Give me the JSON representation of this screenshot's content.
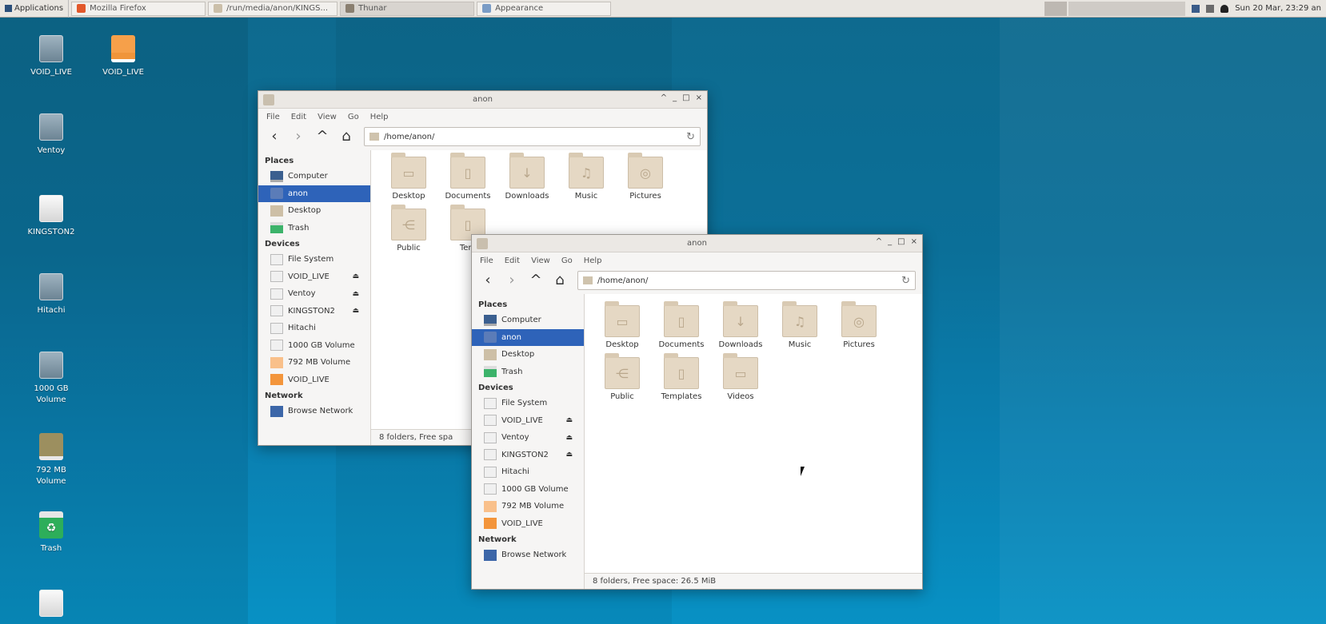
{
  "panel": {
    "apps_label": "Applications",
    "tasks": [
      {
        "label": "Mozilla Firefox",
        "active": false,
        "color": "#e2582b"
      },
      {
        "label": "/run/media/anon/KINGS...",
        "active": false,
        "color": "#cbbfa9"
      },
      {
        "label": "Thunar",
        "active": true,
        "color": "#8a7f70"
      },
      {
        "label": "Appearance",
        "active": false,
        "color": "#7a9cc6"
      }
    ],
    "clock": "Sun 20 Mar, 23:29",
    "user": "an"
  },
  "desktop": {
    "icons": [
      {
        "label": "VOID_LIVE"
      },
      {
        "label": "VOID_LIVE"
      },
      {
        "label": "Ventoy"
      },
      {
        "label": "KINGSTON2"
      },
      {
        "label": "Hitachi"
      },
      {
        "label": "1000 GB Volume"
      },
      {
        "label": "792 MB Volume"
      },
      {
        "label": "Trash"
      }
    ]
  },
  "window_back": {
    "title": "anon",
    "menu": [
      "File",
      "Edit",
      "View",
      "Go",
      "Help"
    ],
    "path": "/home/anon/",
    "sections": {
      "places": "Places",
      "devices": "Devices",
      "network": "Network"
    },
    "places": [
      "Computer",
      "anon",
      "Desktop",
      "Trash"
    ],
    "devices": [
      "File System",
      "VOID_LIVE",
      "Ventoy",
      "KINGSTON2",
      "Hitachi",
      "1000 GB Volume",
      "792 MB Volume",
      "VOID_LIVE"
    ],
    "network": [
      "Browse Network"
    ],
    "folders": [
      "Desktop",
      "Documents",
      "Downloads",
      "Music",
      "Pictures",
      "Public",
      "Tem"
    ],
    "status": "8 folders, Free spa"
  },
  "window_front": {
    "title": "anon",
    "menu": [
      "File",
      "Edit",
      "View",
      "Go",
      "Help"
    ],
    "path": "/home/anon/",
    "sections": {
      "places": "Places",
      "devices": "Devices",
      "network": "Network"
    },
    "places": [
      "Computer",
      "anon",
      "Desktop",
      "Trash"
    ],
    "devices": [
      "File System",
      "VOID_LIVE",
      "Ventoy",
      "KINGSTON2",
      "Hitachi",
      "1000 GB Volume",
      "792 MB Volume",
      "VOID_LIVE"
    ],
    "network": [
      "Browse Network"
    ],
    "folders": [
      "Desktop",
      "Documents",
      "Downloads",
      "Music",
      "Pictures",
      "Public",
      "Templates",
      "Videos"
    ],
    "status": "8 folders, Free space: 26.5 MiB"
  },
  "icons": {
    "back": "‹",
    "forward": "›",
    "up": "^",
    "home": "⌂",
    "reload": "↻",
    "eject": "⏏",
    "minimize": "_",
    "maximize": "□",
    "close": "×",
    "shade": "^"
  }
}
